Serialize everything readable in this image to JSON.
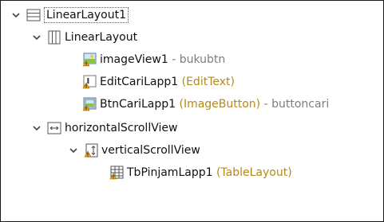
{
  "tree": {
    "root": {
      "label": "LinearLayout1"
    },
    "linear": {
      "label": "LinearLayout"
    },
    "image_view": {
      "label": "imageView1",
      "separator": " - ",
      "value": "bukubtn"
    },
    "edit_text": {
      "label": "EditCariLapp1",
      "type": " (EditText)"
    },
    "image_button": {
      "label": "BtnCariLapp1",
      "type": " (ImageButton)",
      "separator": " - ",
      "value": "buttoncari"
    },
    "hscroll": {
      "label": "horizontalScrollView"
    },
    "vscroll": {
      "label": "verticalScrollView"
    },
    "table": {
      "label": "TbPinjamLapp1",
      "type": " (TableLayout)"
    }
  },
  "colors": {
    "type_suffix": "#b5891e",
    "value_gray": "#7d7d7d",
    "warning": "#e8a317"
  }
}
